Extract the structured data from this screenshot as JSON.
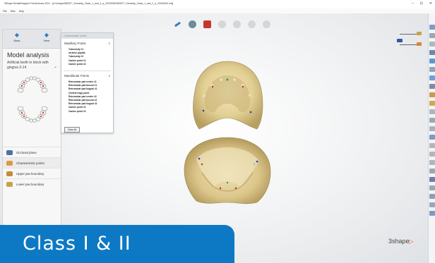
{
  "window": {
    "title": "3Shape DentalDesigner Full dentures 2021 - [s\\:\\Unique\\5833T7_Kennedy_Class_1_and_2_a_20220000\\5833T7_Kennedy_Class_1_and_2_a_20220000.xml]",
    "minimize": "–",
    "maximize": "⊡",
    "close": "✕"
  },
  "menu": [
    "File",
    "View",
    "Help"
  ],
  "nav": {
    "back_label": "Back",
    "next_label": "Next",
    "back_icon": "arrow-left-icon",
    "next_icon": "arrow-right-icon"
  },
  "panel": {
    "title": "Model analysis",
    "subtitle": "Artificial teeth in block with gingiva 3-14",
    "items": [
      {
        "label": "Occlusal plane",
        "icon": "occlusal-plane-icon",
        "color": "#4f6fa8"
      },
      {
        "label": "Characteristic points",
        "icon": "characteristic-points-icon",
        "color": "#d99a4a"
      },
      {
        "label": "Upper jaw boundary",
        "icon": "upper-jaw-icon",
        "color": "#c98a3a"
      },
      {
        "label": "Lower jaw boundary",
        "icon": "lower-jaw-icon",
        "color": "#c9a14a"
      }
    ]
  },
  "popup": {
    "header": "Characteristic points",
    "maxillary": {
      "title": "Maxillary Points",
      "count": "2",
      "points": [
        "Tuberosity #1",
        "Incisive papilla",
        "Tuberosity #2",
        "Canine point #1",
        "Canine point #2"
      ]
    },
    "mandibular": {
      "title": "Mandibular Points",
      "count": "2",
      "points": [
        "Retromolar pad center #1",
        "Retromolar pad buccal #1",
        "Retromolar pad lingual #1",
        "Central ridge point",
        "Retromolar pad center #2",
        "Retromolar pad buccal #2",
        "Retromolar pad lingual #2",
        "Canine point #1",
        "Canine point #2"
      ]
    },
    "clear_label": "Clear All"
  },
  "toolbar": {
    "icons": [
      "tool-pen-icon",
      "tool-mesh-icon",
      "tool-points-icon",
      "tool-tooth-icon",
      "tool-gum-icon",
      "tool-sphere-icon",
      "tool-circle-icon"
    ],
    "colors": [
      "#3a7ac6",
      "#6e8b9e",
      "#c4382b",
      "#d6d6d6",
      "#d6d6d6",
      "#d6d6d6",
      "#d6d6d6"
    ]
  },
  "legend": {
    "icons": [
      "upper-legend-icon",
      "lower-legend-icon",
      "alt-legend-icon"
    ]
  },
  "banner": {
    "text": "Class I & II"
  },
  "logo": {
    "text": "3shape",
    "mark": "▷"
  },
  "colors": {
    "accent": "#0d79c4",
    "model": "#e8d9a8"
  }
}
